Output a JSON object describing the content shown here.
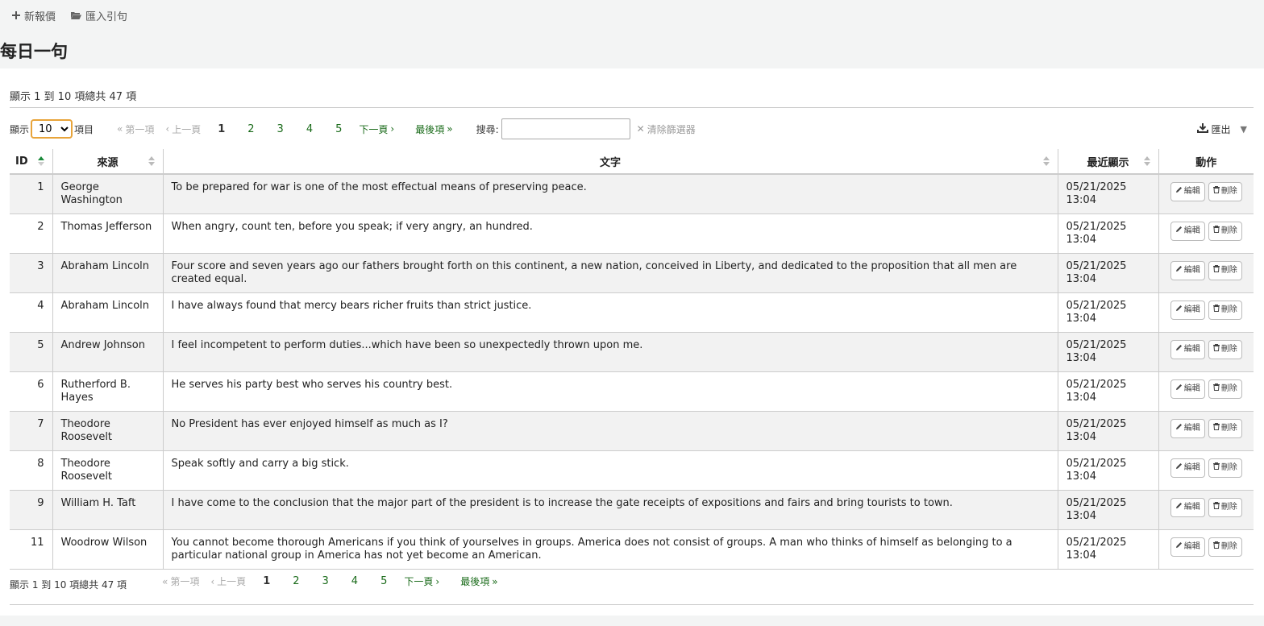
{
  "toolbar": {
    "new_label": "新報價",
    "import_label": "匯入引句"
  },
  "page_title": "每日一句",
  "info_text": "顯示 1 到 10 項總共 47 項",
  "length": {
    "prefix": "顯示",
    "value": "10",
    "suffix": "項目",
    "options": [
      "10"
    ]
  },
  "pager": {
    "first": "第一項",
    "prev": "上一頁",
    "next": "下一頁",
    "last": "最後項",
    "pages": [
      "1",
      "2",
      "3",
      "4",
      "5"
    ],
    "current": "1"
  },
  "search": {
    "label": "搜尋:",
    "value": "",
    "clear_label": "清除篩選器"
  },
  "export_label": "匯出",
  "columns": {
    "id": "ID",
    "source": "來源",
    "text": "文字",
    "last_shown": "最近顯示",
    "actions": "動作"
  },
  "buttons": {
    "edit": "編輯",
    "delete": "刪除"
  },
  "rows": [
    {
      "id": "1",
      "source": "George Washington",
      "text": "To be prepared for war is one of the most effectual means of preserving peace.",
      "date": "05/21/2025",
      "time": "13:04"
    },
    {
      "id": "2",
      "source": "Thomas Jefferson",
      "text": "When angry, count ten, before you speak; if very angry, an hundred.",
      "date": "05/21/2025",
      "time": "13:04"
    },
    {
      "id": "3",
      "source": "Abraham Lincoln",
      "text": "Four score and seven years ago our fathers brought forth on this continent, a new nation, conceived in Liberty, and dedicated to the proposition that all men are created equal.",
      "date": "05/21/2025",
      "time": "13:04"
    },
    {
      "id": "4",
      "source": "Abraham Lincoln",
      "text": "I have always found that mercy bears richer fruits than strict justice.",
      "date": "05/21/2025",
      "time": "13:04"
    },
    {
      "id": "5",
      "source": "Andrew Johnson",
      "text": "I feel incompetent to perform duties...which have been so unexpectedly thrown upon me.",
      "date": "05/21/2025",
      "time": "13:04"
    },
    {
      "id": "6",
      "source": "Rutherford B. Hayes",
      "text": "He serves his party best who serves his country best.",
      "date": "05/21/2025",
      "time": "13:04"
    },
    {
      "id": "7",
      "source": "Theodore Roosevelt",
      "text": "No President has ever enjoyed himself as much as I?",
      "date": "05/21/2025",
      "time": "13:04"
    },
    {
      "id": "8",
      "source": "Theodore Roosevelt",
      "text": "Speak softly and carry a big stick.",
      "date": "05/21/2025",
      "time": "13:04"
    },
    {
      "id": "9",
      "source": "William H. Taft",
      "text": "I have come to the conclusion that the major part of the president is to increase the gate receipts of expositions and fairs and bring tourists to town.",
      "date": "05/21/2025",
      "time": "13:04"
    },
    {
      "id": "11",
      "source": "Woodrow Wilson",
      "text": "You cannot become thorough Americans if you think of yourselves in groups. America does not consist of groups. A man who thinks of himself as belonging to a particular national group in America has not yet become an American.",
      "date": "05/21/2025",
      "time": "13:04"
    }
  ],
  "colors": {
    "link": "#1a6b1a",
    "select_border": "#e8a43a",
    "sort_active": "#1a8a3a"
  }
}
